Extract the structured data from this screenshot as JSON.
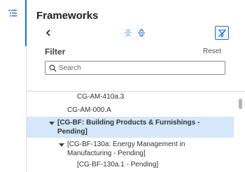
{
  "panel": {
    "title": "Frameworks",
    "icons": {
      "rail": "list-tree-icon",
      "back": "chevron-left-icon",
      "collapse": "collapse-all-icon",
      "expand": "expand-all-icon",
      "filter_toggle": "filter-off-icon"
    },
    "accent_color": "#1f6fd1"
  },
  "filter": {
    "label": "Filter",
    "reset_label": "Reset",
    "search_placeholder": "Search",
    "search_value": ""
  },
  "tree": {
    "selected_color": "#d4e7fb",
    "nodes": [
      {
        "label": "CG-AM-410a.3",
        "expanded": null,
        "selected": false,
        "bold": false
      },
      {
        "label": "CG-AM-000.A",
        "expanded": null,
        "selected": false,
        "bold": false
      },
      {
        "label_line1": "[CG-BF: Building Products & Furnishings -",
        "label_line2": "Pending]",
        "expanded": true,
        "selected": true,
        "bold": true
      },
      {
        "label_line1": "[CG-BF-130a: Energy Management in",
        "label_line2": "Manufacturing - Pending]",
        "expanded": true,
        "selected": false,
        "bold": false
      },
      {
        "label": "[CG-BF-130a.1 - Pending]",
        "expanded": null,
        "selected": false,
        "bold": false
      }
    ]
  }
}
